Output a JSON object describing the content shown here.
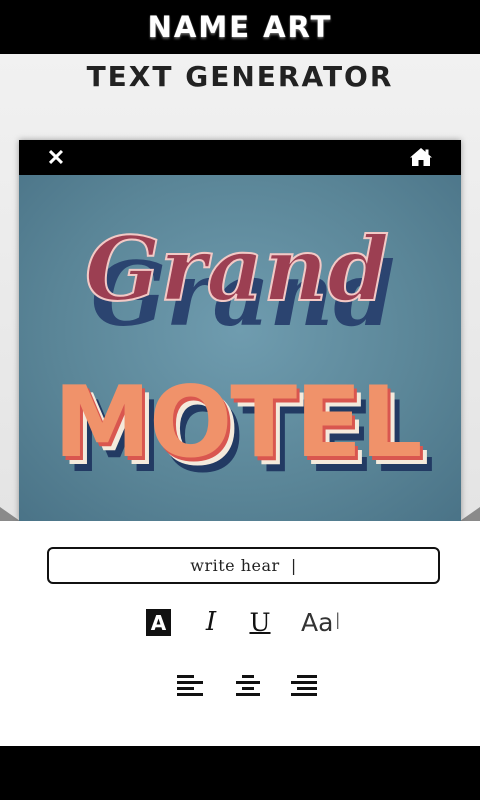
{
  "header": {
    "title": "NAME ART"
  },
  "workspace": {
    "subtitle": "TEXT GENERATOR"
  },
  "viewer": {
    "close_icon": "close-icon",
    "home_icon": "home-icon",
    "artwork": {
      "line1": "Grand",
      "line2": "MOTEL"
    }
  },
  "editor": {
    "input_value": "write hear  |",
    "formatting": {
      "bold_label": "A",
      "italic_label": "I",
      "underline_label": "U",
      "font_size_label": "Aa",
      "font_size_cursor": "I"
    },
    "alignment": [
      "align-left-icon",
      "align-center-icon",
      "align-right-icon"
    ]
  },
  "colors": {
    "bar": "#000000",
    "sky_blue": "#5a8597",
    "motel_orange": "#f0926a",
    "grand_red": "#9c3f52",
    "shadow_navy": "#2b4470"
  }
}
